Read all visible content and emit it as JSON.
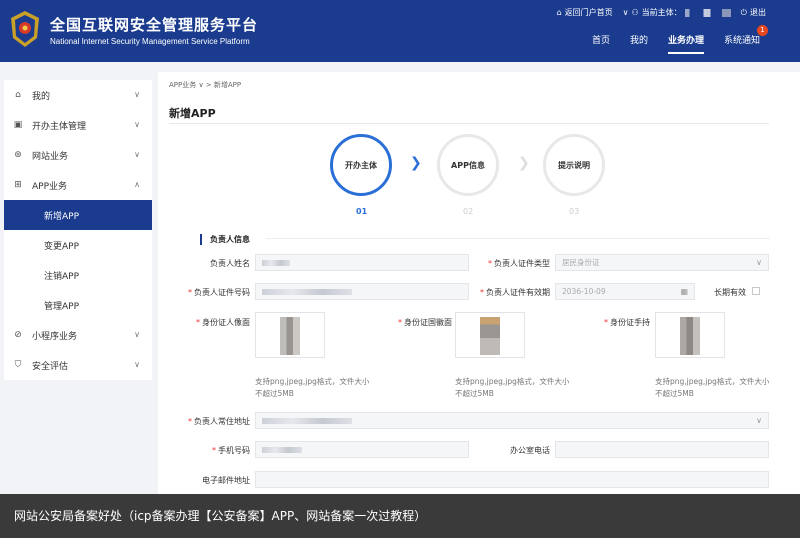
{
  "header": {
    "title_cn": "全国互联网安全管理服务平台",
    "title_en": "National Internet Security Management Service Platform",
    "return_portal": "返回门户首页",
    "current_subject_label": "当前主体：",
    "logout": "退出",
    "nav": [
      {
        "label": "首页"
      },
      {
        "label": "我的"
      },
      {
        "label": "业务办理"
      },
      {
        "label": "系统通知"
      }
    ],
    "notification_count": "1"
  },
  "sidebar": {
    "items": [
      {
        "label": "我的"
      },
      {
        "label": "开办主体管理"
      },
      {
        "label": "网站业务"
      },
      {
        "label": "APP业务"
      },
      {
        "label": "小程序业务"
      },
      {
        "label": "安全评估"
      }
    ],
    "app_sub": [
      {
        "label": "新增APP"
      },
      {
        "label": "变更APP"
      },
      {
        "label": "注销APP"
      },
      {
        "label": "管理APP"
      }
    ]
  },
  "main": {
    "breadcrumb": "APP业务 ∨ > 新增APP",
    "page_title": "新增APP",
    "steps": [
      {
        "label": "开办主体",
        "num": "01"
      },
      {
        "label": "APP信息",
        "num": "02"
      },
      {
        "label": "提示说明",
        "num": "03"
      }
    ],
    "section_title": "负责人信息",
    "fields": {
      "name_label": "负责人姓名",
      "id_type_label": "负责人证件类型",
      "id_type_value": "居民身份证",
      "id_number_label": "负责人证件号码",
      "id_valid_label": "负责人证件有效期",
      "id_valid_value": "2036-10-09",
      "long_term_label": "长期有效",
      "photo_portrait_label": "身份证人像面",
      "photo_emblem_label": "身份证国徽面",
      "photo_hold_label": "身份证手持",
      "upload_hint": "支持png,jpeg,jpg格式，文件大小不超过5MB",
      "address_label": "负责人常住地址",
      "phone_label": "手机号码",
      "office_phone_label": "办公室电话",
      "email_label": "电子邮件地址"
    }
  },
  "caption": "网站公安局备案好处（icp备案办理【公安备案】APP、网站备案一次过教程）",
  "colors": {
    "header_bg": "#1a3b8e",
    "accent": "#2a6fd6",
    "active_menu": "#1a3b8e"
  }
}
